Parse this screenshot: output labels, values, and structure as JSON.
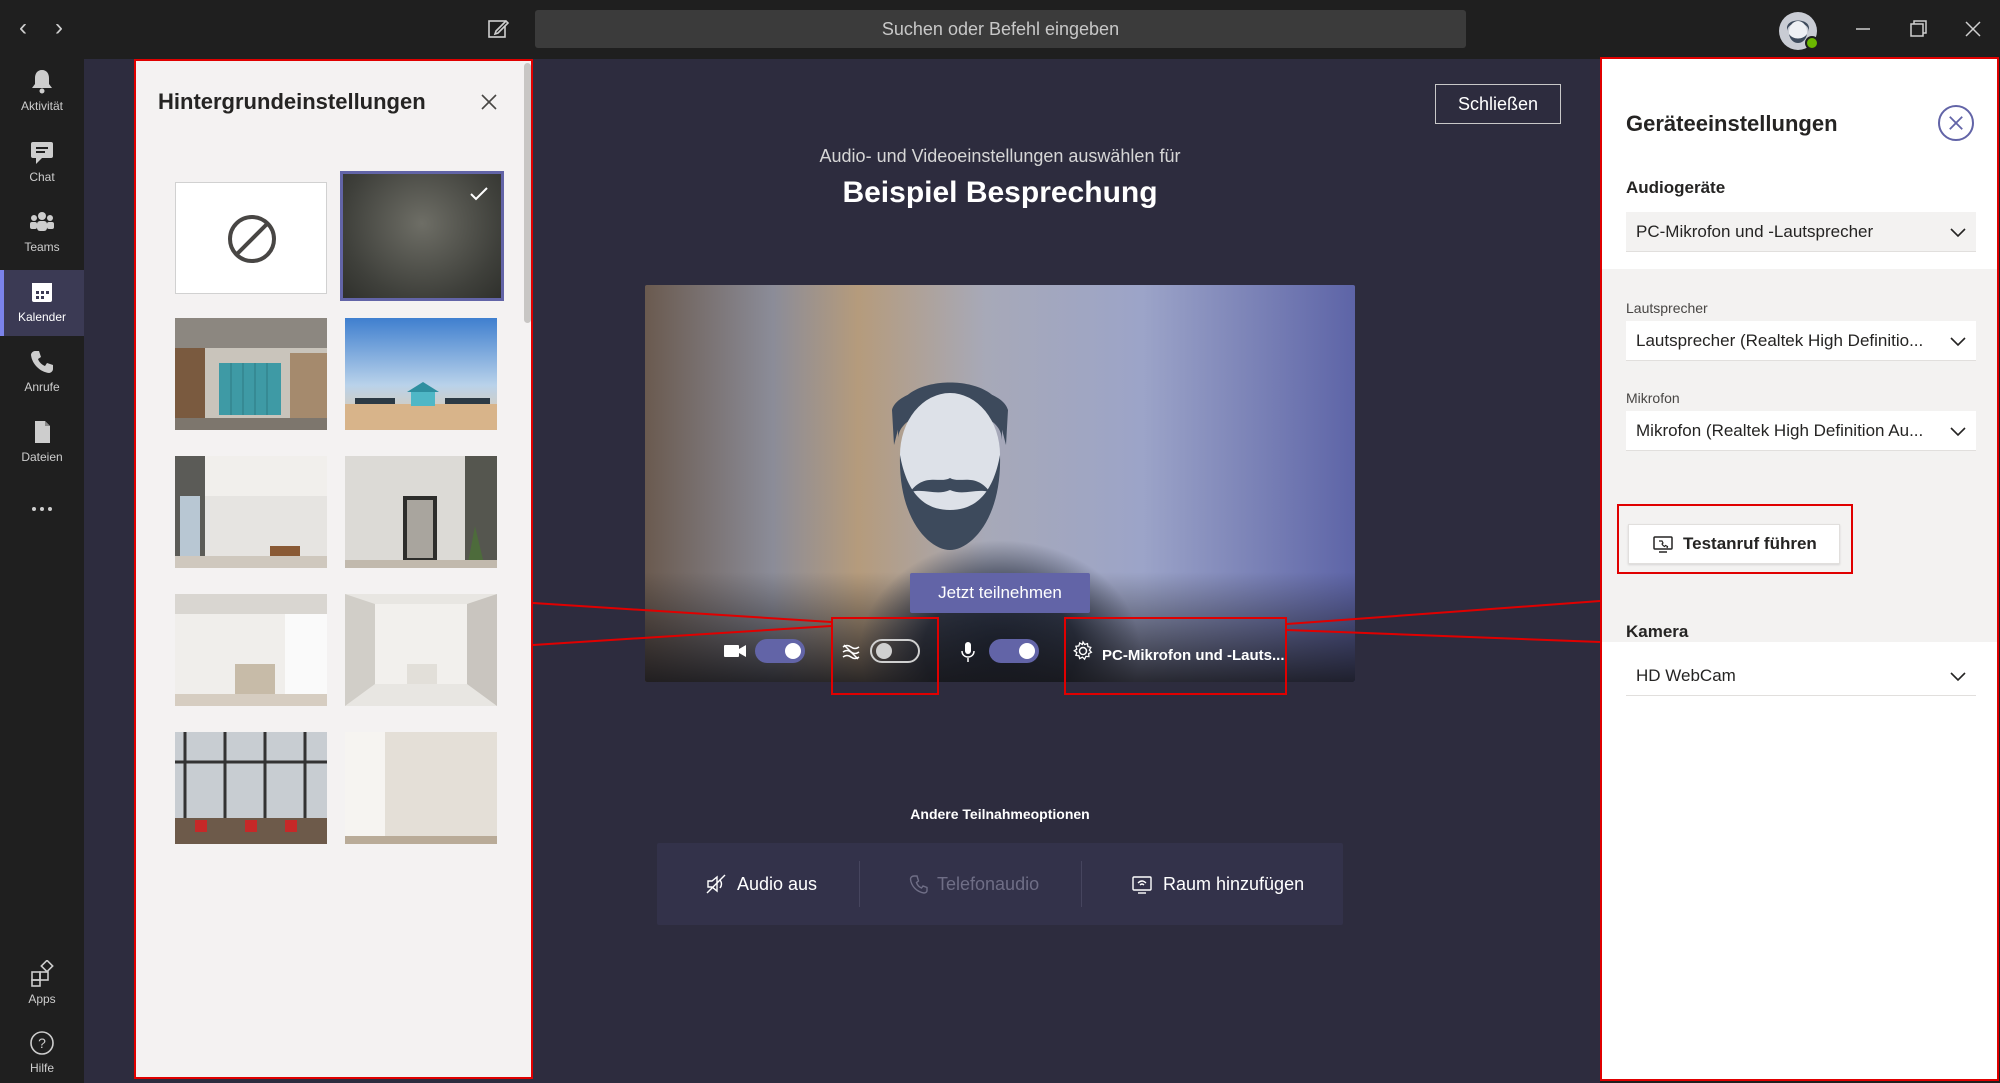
{
  "titlebar": {
    "search_placeholder": "Suchen oder Befehl eingeben"
  },
  "rail": {
    "items": [
      {
        "label": "Aktivität",
        "icon": "bell-icon"
      },
      {
        "label": "Chat",
        "icon": "chat-icon"
      },
      {
        "label": "Teams",
        "icon": "teams-icon"
      },
      {
        "label": "Kalender",
        "icon": "calendar-icon",
        "active": true
      },
      {
        "label": "Anrufe",
        "icon": "phone-icon"
      },
      {
        "label": "Dateien",
        "icon": "file-icon"
      }
    ],
    "bottom": [
      {
        "label": "Apps",
        "icon": "apps-icon"
      },
      {
        "label": "Hilfe",
        "icon": "help-icon"
      }
    ]
  },
  "background_panel": {
    "title": "Hintergrundeinstellungen"
  },
  "stage": {
    "close_label": "Schließen",
    "subtitle": "Audio- und Videoeinstellungen auswählen für",
    "meeting_title": "Beispiel Besprechung",
    "join_label": "Jetzt teilnehmen",
    "device_label": "PC-Mikrofon und -Lauts...",
    "camera_on": true,
    "blur_on": false,
    "mic_on": true,
    "other_options_label": "Andere Teilnahmeoptionen",
    "options": [
      {
        "label": "Audio aus",
        "icon": "speaker-off-icon",
        "enabled": true
      },
      {
        "label": "Telefonaudio",
        "icon": "phone-icon",
        "enabled": false
      },
      {
        "label": "Raum hinzufügen",
        "icon": "room-icon",
        "enabled": true
      }
    ]
  },
  "device_panel": {
    "title": "Geräteeinstellungen",
    "audio_label": "Audiogeräte",
    "audio_value": "PC-Mikrofon und -Lautsprecher",
    "speaker_label": "Lautsprecher",
    "speaker_value": "Lautsprecher (Realtek High Definitio...",
    "mic_label": "Mikrofon",
    "mic_value": "Mikrofon (Realtek High Definition Au...",
    "test_call_label": "Testanruf führen",
    "camera_label": "Kamera",
    "camera_value": "HD WebCam"
  },
  "colors": {
    "accent": "#6264a7",
    "stage_bg": "#2d2c3e",
    "annotation": "#e00000"
  }
}
